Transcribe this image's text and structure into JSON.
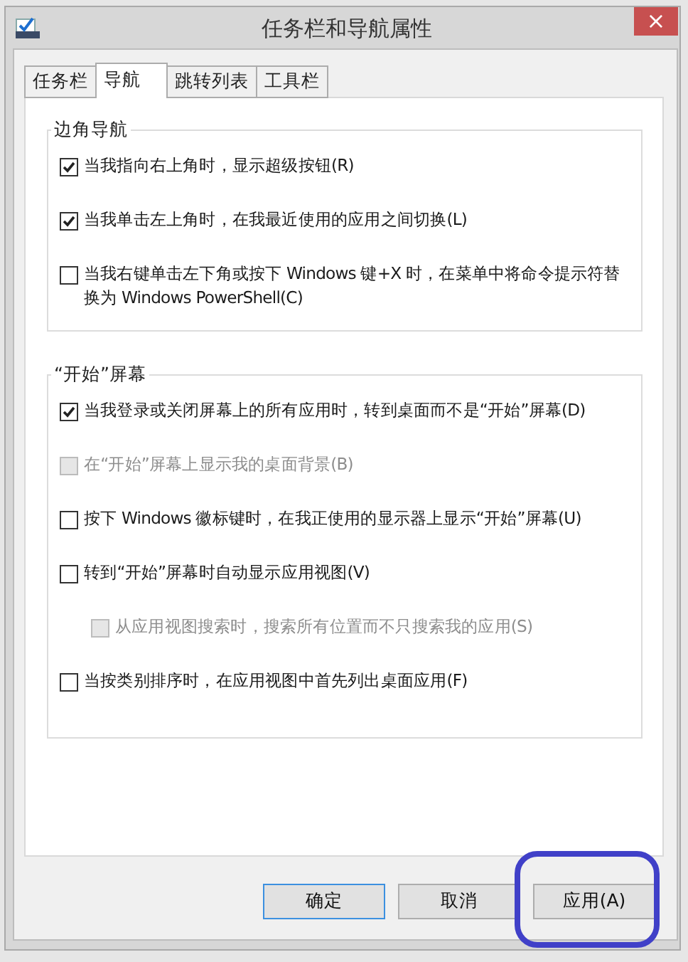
{
  "window": {
    "title": "任务栏和导航属性",
    "close": "×"
  },
  "tabs": [
    {
      "label": "任务栏",
      "selected": false
    },
    {
      "label": "导航",
      "selected": true
    },
    {
      "label": "跳转列表",
      "selected": false
    },
    {
      "label": "工具栏",
      "selected": false
    }
  ],
  "groups": [
    {
      "title": "边角导航",
      "options": [
        {
          "label": "当我指向右上角时，显示超级按钮(R)",
          "checked": true,
          "disabled": false
        },
        {
          "label": "当我单击左上角时，在我最近使用的应用之间切换(L)",
          "checked": true,
          "disabled": false
        },
        {
          "label": "当我右键单击左下角或按下 Windows 键+X 时，在菜单中将命令提示符替换为 Windows PowerShell(C)",
          "checked": false,
          "disabled": false
        }
      ]
    },
    {
      "title": "“开始”屏幕",
      "options": [
        {
          "label": "当我登录或关闭屏幕上的所有应用时，转到桌面而不是“开始”屏幕(D)",
          "checked": true,
          "disabled": false
        },
        {
          "label": "在“开始”屏幕上显示我的桌面背景(B)",
          "checked": false,
          "disabled": true
        },
        {
          "label": "按下 Windows 徽标键时，在我正使用的显示器上显示“开始”屏幕(U)",
          "checked": false,
          "disabled": false
        },
        {
          "label": "转到“开始”屏幕时自动显示应用视图(V)",
          "checked": false,
          "disabled": false,
          "children": [
            {
              "label": "从应用视图搜索时，搜索所有位置而不只搜索我的应用(S)",
              "checked": false,
              "disabled": true
            }
          ]
        },
        {
          "label": "当按类别排序时，在应用视图中首先列出桌面应用(F)",
          "checked": false,
          "disabled": false
        }
      ]
    }
  ],
  "buttons": [
    {
      "label": "确定",
      "default": true
    },
    {
      "label": "取消",
      "default": false
    },
    {
      "label": "应用(A)",
      "default": false
    }
  ]
}
